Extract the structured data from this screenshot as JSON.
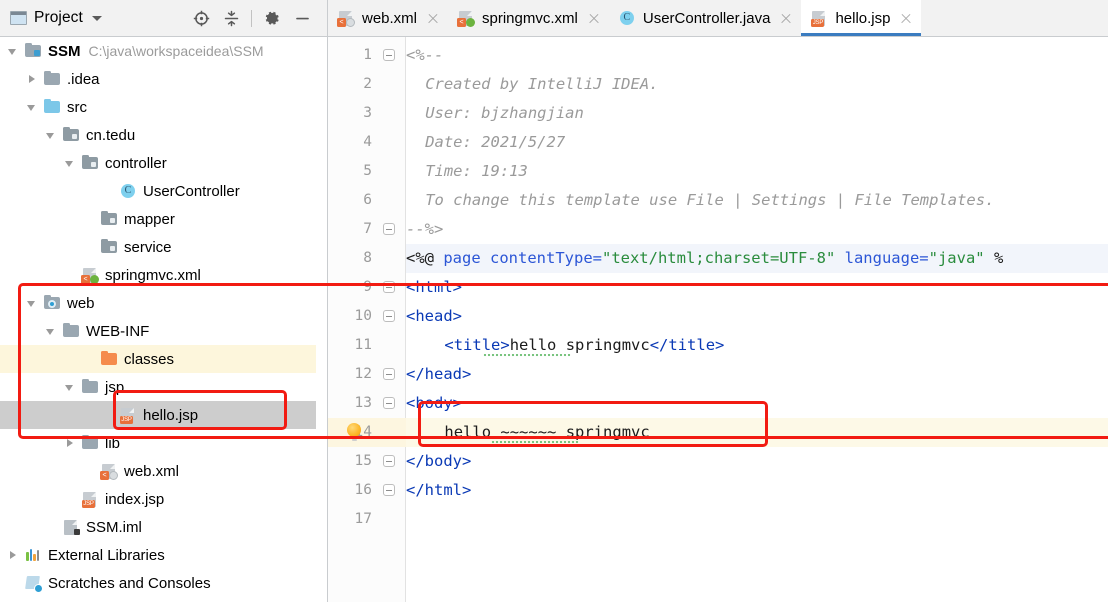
{
  "sidebar": {
    "title": "Project",
    "title_icon": "project-window-icon",
    "dropdown_icon": "chevron-down-icon",
    "tools": [
      {
        "name": "select-opened-file-icon",
        "label": "Select Opened File"
      },
      {
        "name": "collapse-all-icon",
        "label": "Collapse All"
      },
      {
        "name": "gear-icon",
        "label": "Settings"
      },
      {
        "name": "minimize-icon",
        "label": "Hide"
      }
    ],
    "tree": [
      {
        "label": "SSM",
        "detail": "C:\\java\\workspaceidea\\SSM",
        "indent": 0,
        "arrow": "down",
        "icon": "module-folder-icon",
        "bold": true,
        "state": "normal"
      },
      {
        "label": ".idea",
        "detail": "",
        "indent": 1,
        "arrow": "right",
        "icon": "folder-gray-icon",
        "bold": false,
        "state": "normal"
      },
      {
        "label": "src",
        "detail": "",
        "indent": 1,
        "arrow": "down",
        "icon": "folder-blue-icon",
        "bold": false,
        "state": "normal"
      },
      {
        "label": "cn.tedu",
        "detail": "",
        "indent": 2,
        "arrow": "down",
        "icon": "package-icon",
        "bold": false,
        "state": "normal"
      },
      {
        "label": "controller",
        "detail": "",
        "indent": 3,
        "arrow": "down",
        "icon": "package-icon",
        "bold": false,
        "state": "normal"
      },
      {
        "label": "UserController",
        "detail": "",
        "indent": 5,
        "arrow": "none",
        "icon": "java-class-icon",
        "bold": false,
        "state": "normal"
      },
      {
        "label": "mapper",
        "detail": "",
        "indent": 4,
        "arrow": "none",
        "icon": "package-icon",
        "bold": false,
        "state": "normal"
      },
      {
        "label": "service",
        "detail": "",
        "indent": 4,
        "arrow": "none",
        "icon": "package-icon",
        "bold": false,
        "state": "normal"
      },
      {
        "label": "springmvc.xml",
        "detail": "",
        "indent": 3,
        "arrow": "none",
        "icon": "spring-xml-icon",
        "bold": false,
        "state": "normal"
      },
      {
        "label": "web",
        "detail": "",
        "indent": 1,
        "arrow": "down",
        "icon": "web-folder-icon",
        "bold": false,
        "state": "normal"
      },
      {
        "label": "WEB-INF",
        "detail": "",
        "indent": 2,
        "arrow": "down",
        "icon": "folder-gray-icon",
        "bold": false,
        "state": "normal"
      },
      {
        "label": "classes",
        "detail": "",
        "indent": 4,
        "arrow": "none",
        "icon": "folder-orange-icon",
        "bold": false,
        "state": "cream"
      },
      {
        "label": "jsp",
        "detail": "",
        "indent": 3,
        "arrow": "down",
        "icon": "folder-gray-icon",
        "bold": false,
        "state": "normal"
      },
      {
        "label": "hello.jsp",
        "detail": "",
        "indent": 5,
        "arrow": "none",
        "icon": "jsp-file-icon",
        "bold": false,
        "state": "selected"
      },
      {
        "label": "lib",
        "detail": "",
        "indent": 3,
        "arrow": "right",
        "icon": "folder-gray-icon",
        "bold": false,
        "state": "normal"
      },
      {
        "label": "web.xml",
        "detail": "",
        "indent": 4,
        "arrow": "none",
        "icon": "web-xml-icon",
        "bold": false,
        "state": "normal"
      },
      {
        "label": "index.jsp",
        "detail": "",
        "indent": 3,
        "arrow": "none",
        "icon": "jsp-file-icon",
        "bold": false,
        "state": "normal"
      },
      {
        "label": "SSM.iml",
        "detail": "",
        "indent": 2,
        "arrow": "none",
        "icon": "iml-file-icon",
        "bold": false,
        "state": "normal"
      },
      {
        "label": "External Libraries",
        "detail": "",
        "indent": 0,
        "arrow": "right",
        "icon": "external-libraries-icon",
        "bold": false,
        "state": "normal"
      },
      {
        "label": "Scratches and Consoles",
        "detail": "",
        "indent": 0,
        "arrow": "none",
        "icon": "scratches-icon",
        "bold": false,
        "state": "normal"
      }
    ]
  },
  "editor": {
    "tabs": [
      {
        "label": "web.xml",
        "icon": "web-xml-icon",
        "active": false
      },
      {
        "label": "springmvc.xml",
        "icon": "spring-xml-icon",
        "active": false
      },
      {
        "label": "UserController.java",
        "icon": "java-class-icon",
        "active": false
      },
      {
        "label": "hello.jsp",
        "icon": "jsp-file-icon",
        "active": true
      }
    ],
    "line_numbers": [
      "1",
      "2",
      "3",
      "4",
      "5",
      "6",
      "7",
      "8",
      "9",
      "10",
      "11",
      "12",
      "13",
      "14",
      "15",
      "16",
      "17"
    ],
    "lines": [
      {
        "n": 1,
        "segments": [
          {
            "t": "<%--",
            "c": "cmt"
          }
        ],
        "indent": 0
      },
      {
        "n": 2,
        "segments": [
          {
            "t": "Created by IntelliJ IDEA.",
            "c": "cmt"
          }
        ],
        "indent": 2
      },
      {
        "n": 3,
        "segments": [
          {
            "t": "User: bjzhangjian",
            "c": "cmt"
          }
        ],
        "indent": 2
      },
      {
        "n": 4,
        "segments": [
          {
            "t": "Date: 2021/5/27",
            "c": "cmt"
          }
        ],
        "indent": 2
      },
      {
        "n": 5,
        "segments": [
          {
            "t": "Time: 19:13",
            "c": "cmt"
          }
        ],
        "indent": 2
      },
      {
        "n": 6,
        "segments": [
          {
            "t": "To change this template use File | Settings | File Templates.",
            "c": "cmt"
          }
        ],
        "indent": 2
      },
      {
        "n": 7,
        "segments": [
          {
            "t": "--%>",
            "c": "cmt"
          }
        ],
        "indent": 0
      },
      {
        "n": 8,
        "segments": [
          {
            "t": "<%@ ",
            "c": "plain"
          },
          {
            "t": "page ",
            "c": "attr"
          },
          {
            "t": "contentType=",
            "c": "attr"
          },
          {
            "t": "\"text/html;charset=UTF-8\"",
            "c": "str"
          },
          {
            "t": " ",
            "c": "plain"
          },
          {
            "t": "language=",
            "c": "attr"
          },
          {
            "t": "\"java\"",
            "c": "str"
          },
          {
            "t": " %",
            "c": "plain"
          }
        ],
        "indent": 0
      },
      {
        "n": 9,
        "segments": [
          {
            "t": "<html>",
            "c": "tag"
          }
        ],
        "indent": 0
      },
      {
        "n": 10,
        "segments": [
          {
            "t": "<head>",
            "c": "tag"
          }
        ],
        "indent": 0
      },
      {
        "n": 11,
        "segments": [
          {
            "t": "<title>",
            "c": "tag"
          },
          {
            "t": "hello springmvc",
            "c": "plain"
          },
          {
            "t": "</title>",
            "c": "tag"
          }
        ],
        "indent": 4
      },
      {
        "n": 12,
        "segments": [
          {
            "t": "</head>",
            "c": "tag"
          }
        ],
        "indent": 0
      },
      {
        "n": 13,
        "segments": [
          {
            "t": "<body>",
            "c": "tag"
          }
        ],
        "indent": 0
      },
      {
        "n": 14,
        "segments": [
          {
            "t": "hello ~~~~~~ springmvc",
            "c": "plain"
          }
        ],
        "indent": 4
      },
      {
        "n": 15,
        "segments": [
          {
            "t": "</body>",
            "c": "tag"
          }
        ],
        "indent": 0
      },
      {
        "n": 16,
        "segments": [
          {
            "t": "</html>",
            "c": "tag"
          }
        ],
        "indent": 0
      },
      {
        "n": 17,
        "segments": [],
        "indent": 0
      }
    ],
    "intention_bulb": {
      "name": "intention-bulb-icon",
      "line": 14
    },
    "current_line": 14
  },
  "annotations": {
    "color": "#f21b12",
    "boxes": [
      {
        "name": "highlight-web-folder-region"
      },
      {
        "name": "highlight-hello-jsp-node"
      },
      {
        "name": "highlight-hello-springmvc-text"
      }
    ]
  },
  "colors": {
    "accent_blue": "#3b7cc0",
    "tag_blue": "#0a39b5",
    "attr_blue": "#2c56d6",
    "string_green": "#2a8c3d",
    "comment_gray": "#9a9a9a",
    "annotation_red": "#f21b12",
    "selection_gray": "#cdcdcd",
    "cream_highlight": "#fdf6dc"
  }
}
